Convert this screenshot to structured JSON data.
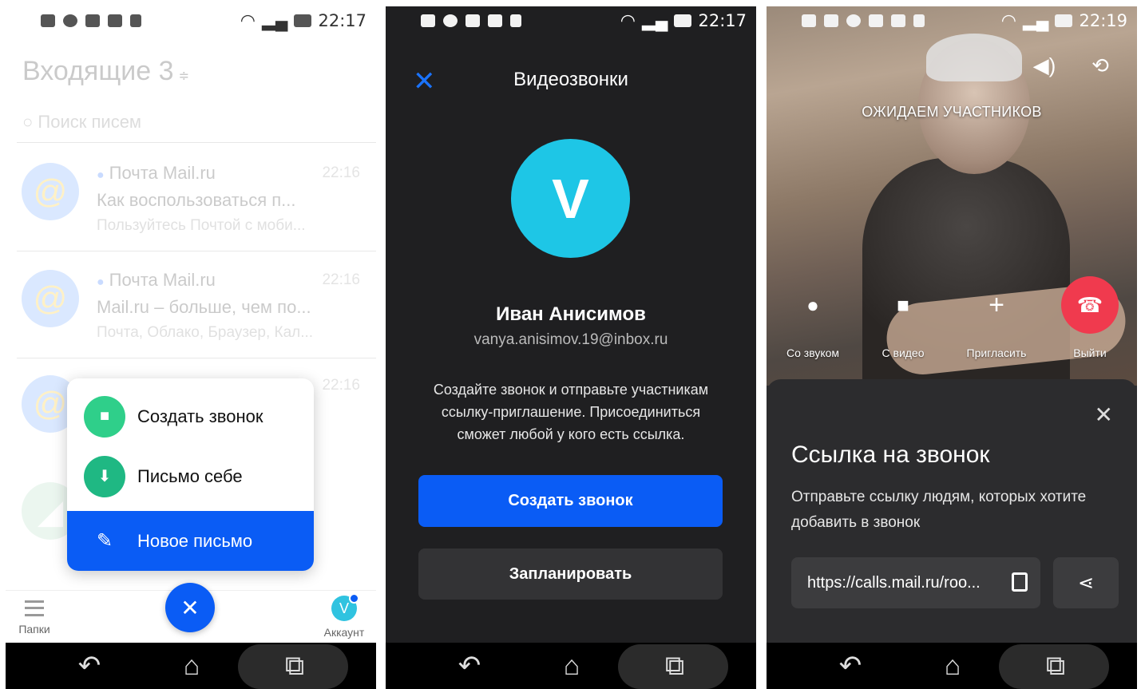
{
  "status_bars": [
    {
      "time": "22:17"
    },
    {
      "time": "22:17"
    },
    {
      "time": "22:19"
    }
  ],
  "inbox": {
    "title": "Входящие 3",
    "search_placeholder": "Поиск писем",
    "mails": [
      {
        "from": "Почта Mail.ru",
        "time": "22:16",
        "subject": "Как воспользоваться п...",
        "snippet": "Пользуйтесь Почтой с моби..."
      },
      {
        "from": "Почта Mail.ru",
        "time": "22:16",
        "subject": "Mail.ru – больше, чем по...",
        "snippet": "Почта, Облако, Браузер, Кал..."
      },
      {
        "from": "",
        "time": "22:16",
        "subject": "",
        "snippet": ""
      }
    ],
    "fab_menu": [
      {
        "label": "Создать звонок",
        "icon": "video-camera-icon",
        "color": "#2fcf8a"
      },
      {
        "label": "Письмо себе",
        "icon": "download-icon",
        "color": "#1fb883"
      },
      {
        "label": "Новое письмо",
        "icon": "pencil-icon",
        "color": "#0a5cf5"
      }
    ],
    "tabbar": {
      "folders_label": "Папки",
      "account_label": "Аккаунт",
      "account_initial": "V"
    }
  },
  "videocall": {
    "title": "Видеозвонки",
    "avatar_initial": "V",
    "name": "Иван Анисимов",
    "email": "vanya.anisimov.19@inbox.ru",
    "description": "Создайте звонок и отправьте участникам ссылку-приглашение. Присоединиться сможет любой у кого есть ссылка.",
    "create_button": "Создать звонок",
    "schedule_button": "Запланировать"
  },
  "call": {
    "waiting_label": "ОЖИДАЕМ УЧАСТНИКОВ",
    "controls": [
      {
        "label": "Со звуком",
        "icon": "microphone-icon"
      },
      {
        "label": "С видео",
        "icon": "video-camera-icon"
      },
      {
        "label": "Пригласить",
        "icon": "plus-icon"
      },
      {
        "label": "Выйти",
        "icon": "hang-up-icon"
      }
    ],
    "sheet": {
      "title": "Ссылка на звонок",
      "description": "Отправьте ссылку людям, которых хотите добавить в звонок",
      "link": "https://calls.mail.ru/roo..."
    }
  },
  "colors": {
    "accent": "#0a5cf5",
    "end_call": "#f03a4e",
    "avatar": "#1ec6e6"
  }
}
